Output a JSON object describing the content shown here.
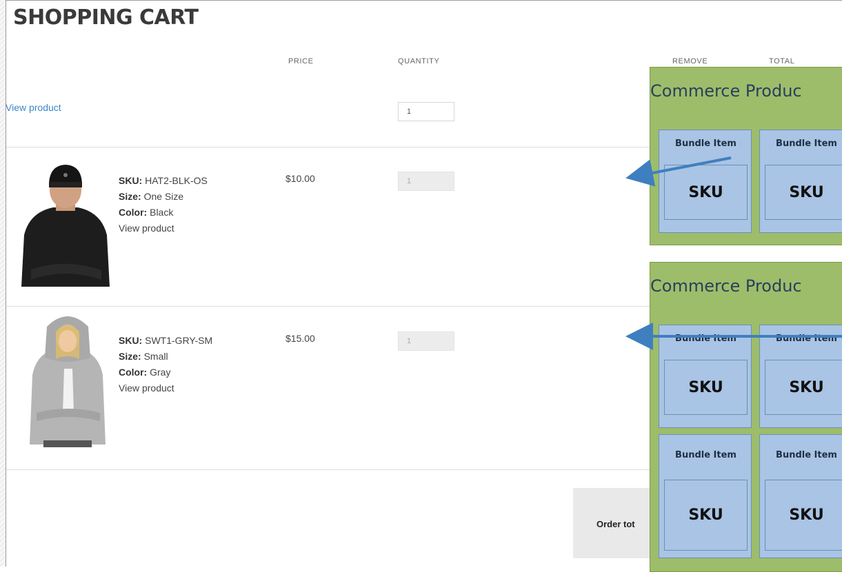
{
  "cart": {
    "title": "SHOPPING CART",
    "headers": {
      "price": "PRICE",
      "quantity": "QUANTITY",
      "remove": "REMOVE",
      "total": "TOTAL"
    },
    "bundle_row": {
      "link": "View product",
      "quantity": "1"
    },
    "items": [
      {
        "sku_label": "SKU:",
        "sku": "HAT2-BLK-OS",
        "size_label": "Size:",
        "size": "One Size",
        "color_label": "Color:",
        "color": "Black",
        "link": "View product",
        "price": "$10.00",
        "quantity": "1",
        "image": "person-in-black-beanie-and-shirt"
      },
      {
        "sku_label": "SKU:",
        "sku": "SWT1-GRY-SM",
        "size_label": "Size:",
        "size": "Small",
        "color_label": "Color:",
        "color": "Gray",
        "link": "View product",
        "price": "$15.00",
        "quantity": "1",
        "image": "person-in-gray-hoodie"
      }
    ],
    "order_total_label": "Order tot"
  },
  "overlays": [
    {
      "title": "Commerce Produc",
      "bundles": [
        {
          "label": "Bundle Item",
          "sku": "SKU"
        },
        {
          "label": "Bundle Item",
          "sku": "SKU"
        }
      ]
    },
    {
      "title": "Commerce Produc",
      "bundles": [
        {
          "label": "Bundle Item",
          "sku": "SKU"
        },
        {
          "label": "Bundle Item",
          "sku": "SKU"
        },
        {
          "label": "Bundle Item",
          "sku": "SKU"
        },
        {
          "label": "Bundle Item",
          "sku": "SKU"
        }
      ]
    }
  ],
  "colors": {
    "link": "#3a87c7",
    "overlay_green": "#9dbd6b",
    "bundle_blue": "#a9c4e4",
    "arrow_blue": "#3f7fbf"
  },
  "icons": [
    "arrow-left-icon"
  ]
}
